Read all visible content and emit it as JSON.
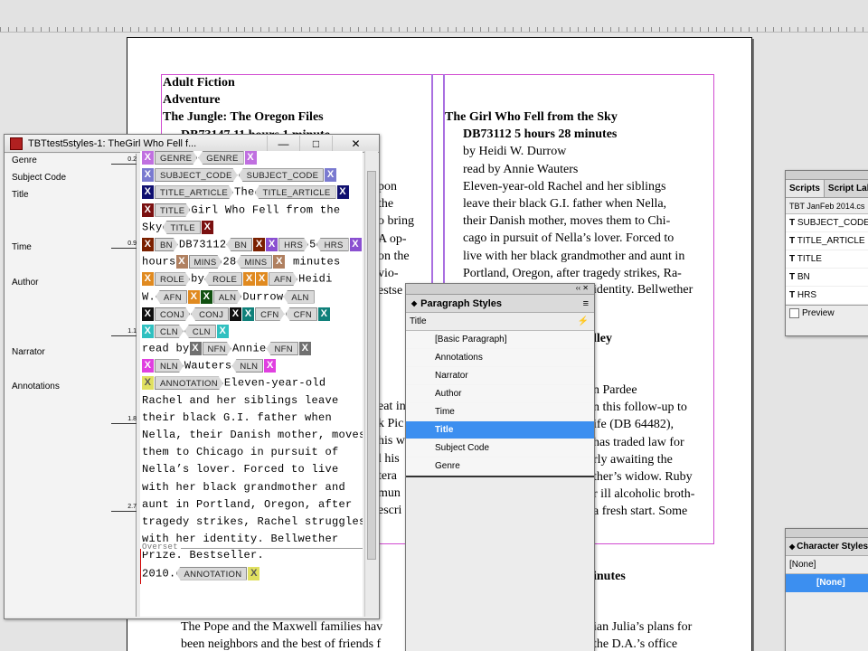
{
  "document": {
    "col1_lines": [
      "Adult Fiction",
      "Adventure",
      "The Jungle: The Oregon Files",
      "DB73147 11 hours 1 minute"
    ],
    "col1_behind": [
      "pon",
      "the",
      "o bring",
      "A op-",
      "on the",
      "vio-",
      "estse"
    ],
    "col1_lower": [
      "eat in",
      "k Pic",
      "his w",
      "l his",
      "tera",
      "mun",
      "escri"
    ],
    "col1_bottom": [
      "The Pope and the Maxwell families hav",
      "been neighbors and the best of friends f"
    ],
    "col2_title": "The Girl Who Fell from the Sky",
    "col2_db": "DB73112 5 hours 28 minutes",
    "col2_author": "by Heidi W. Durrow",
    "col2_narrator": "read by Annie Wauters",
    "col2_annotation": [
      "Eleven-year-old Rachel and her siblings",
      "leave their black G.I. father when Nella,",
      "their Danish mother, moves them to Chi-",
      "cago in pursuit of Nella’s lover. Forced to",
      "live with her black grandmother and aunt in",
      "Portland, Oregon, after tragedy strikes, Ra-",
      "identity. Bellwether"
    ],
    "col2_lower": [
      "lley",
      "n Pardee",
      "n this follow-up to",
      "ife (DB 64482),",
      "has traded law for",
      "rly awaiting the",
      "ther’s widow. Ruby",
      "r ill alcoholic broth-",
      "a fresh start. Some"
    ],
    "col2_min": "inutes",
    "col2_bottom": [
      "ian Julia’s plans for",
      "the D.A.’s office"
    ]
  },
  "story_editor": {
    "title": "TBTtest5styles-1:   TheGirl Who Fell f...",
    "labels": [
      "Genre",
      "Subject Code",
      "Title",
      "Time",
      "Author",
      "Narrator",
      "Annotations"
    ],
    "depths": [
      "0.2",
      "0.9",
      "1.1",
      "1.8",
      "2.7"
    ],
    "tags": {
      "genre": "GENRE",
      "subject_code": "SUBJECT_CODE",
      "title_article": "TITLE_ARTICLE",
      "title": "TITLE",
      "bn": "BN",
      "hrs": "HRS",
      "mins": "MINS",
      "role": "ROLE",
      "afn": "AFN",
      "aln": "ALN",
      "conj": "CONJ",
      "cfn": "CFN",
      "cln": "CLN",
      "nfn": "NFN",
      "nln": "NLN",
      "annotation": "ANNOTATION"
    },
    "text": {
      "the": "The",
      "title1": "Girl Who Fell from the",
      "sky": "Sky",
      "bn": "DB73112",
      "hrs": "5",
      "minutes": " minutes",
      "hours": "hours",
      "mins": "28",
      "by": "by",
      "heidi": "Heidi",
      "w": "W.",
      "durrow": "Durrow",
      "read_by": "read by",
      "annie": "Annie",
      "wauters": "Wauters",
      "ann1": "Eleven-year-old",
      "ann": [
        "Rachel and her siblings leave",
        "their black G.I. father when",
        "Nella, their Danish mother, moves",
        "them to Chicago in pursuit of",
        "Nella’s lover. Forced to live",
        "with her black grandmother and",
        "aunt in Portland, Oregon, after",
        "tragedy strikes, Rachel struggles",
        "with her identity. Bellwether"
      ],
      "overset": "Overset",
      "prize": "Prize. Bestseller.",
      "year": "2010."
    },
    "window_buttons": {
      "minimize": "—",
      "maximize": "□",
      "close": "✕"
    }
  },
  "paragraph_styles": {
    "title": "Paragraph Styles",
    "current": "Title",
    "items": [
      "[Basic Paragraph]",
      "Annotations",
      "Narrator",
      "Author",
      "Time",
      "Title",
      "Subject Code",
      "Genre"
    ],
    "selected": "Title"
  },
  "scripts_panel": {
    "tabs": [
      "Scripts",
      "Script Lab"
    ],
    "file": "TBT JanFeb 2014.cs",
    "items": [
      "SUBJECT_CODE",
      "TITLE_ARTICLE",
      "TITLE",
      "BN",
      "HRS"
    ],
    "preview": "Preview"
  },
  "character_styles": {
    "title": "Character Styles",
    "current": "[None]",
    "items": [
      "[None]"
    ]
  },
  "colors": {
    "genre": "#c070e0",
    "subject": "#7a7ad0",
    "title_article": "#101070",
    "title": "#7a1010",
    "bn": "#7a2000",
    "hrs": "#8a50d0",
    "mins": "#b08060",
    "role": "#e08a20",
    "afn": "#e08a20",
    "aln": "#105010",
    "conj": "#101010",
    "cfn": "#10807a",
    "cln": "#30c0c0",
    "nfn": "#707070",
    "nln": "#e040e0",
    "annotation": "#e0e060",
    "selection": "#3c8ff0"
  }
}
